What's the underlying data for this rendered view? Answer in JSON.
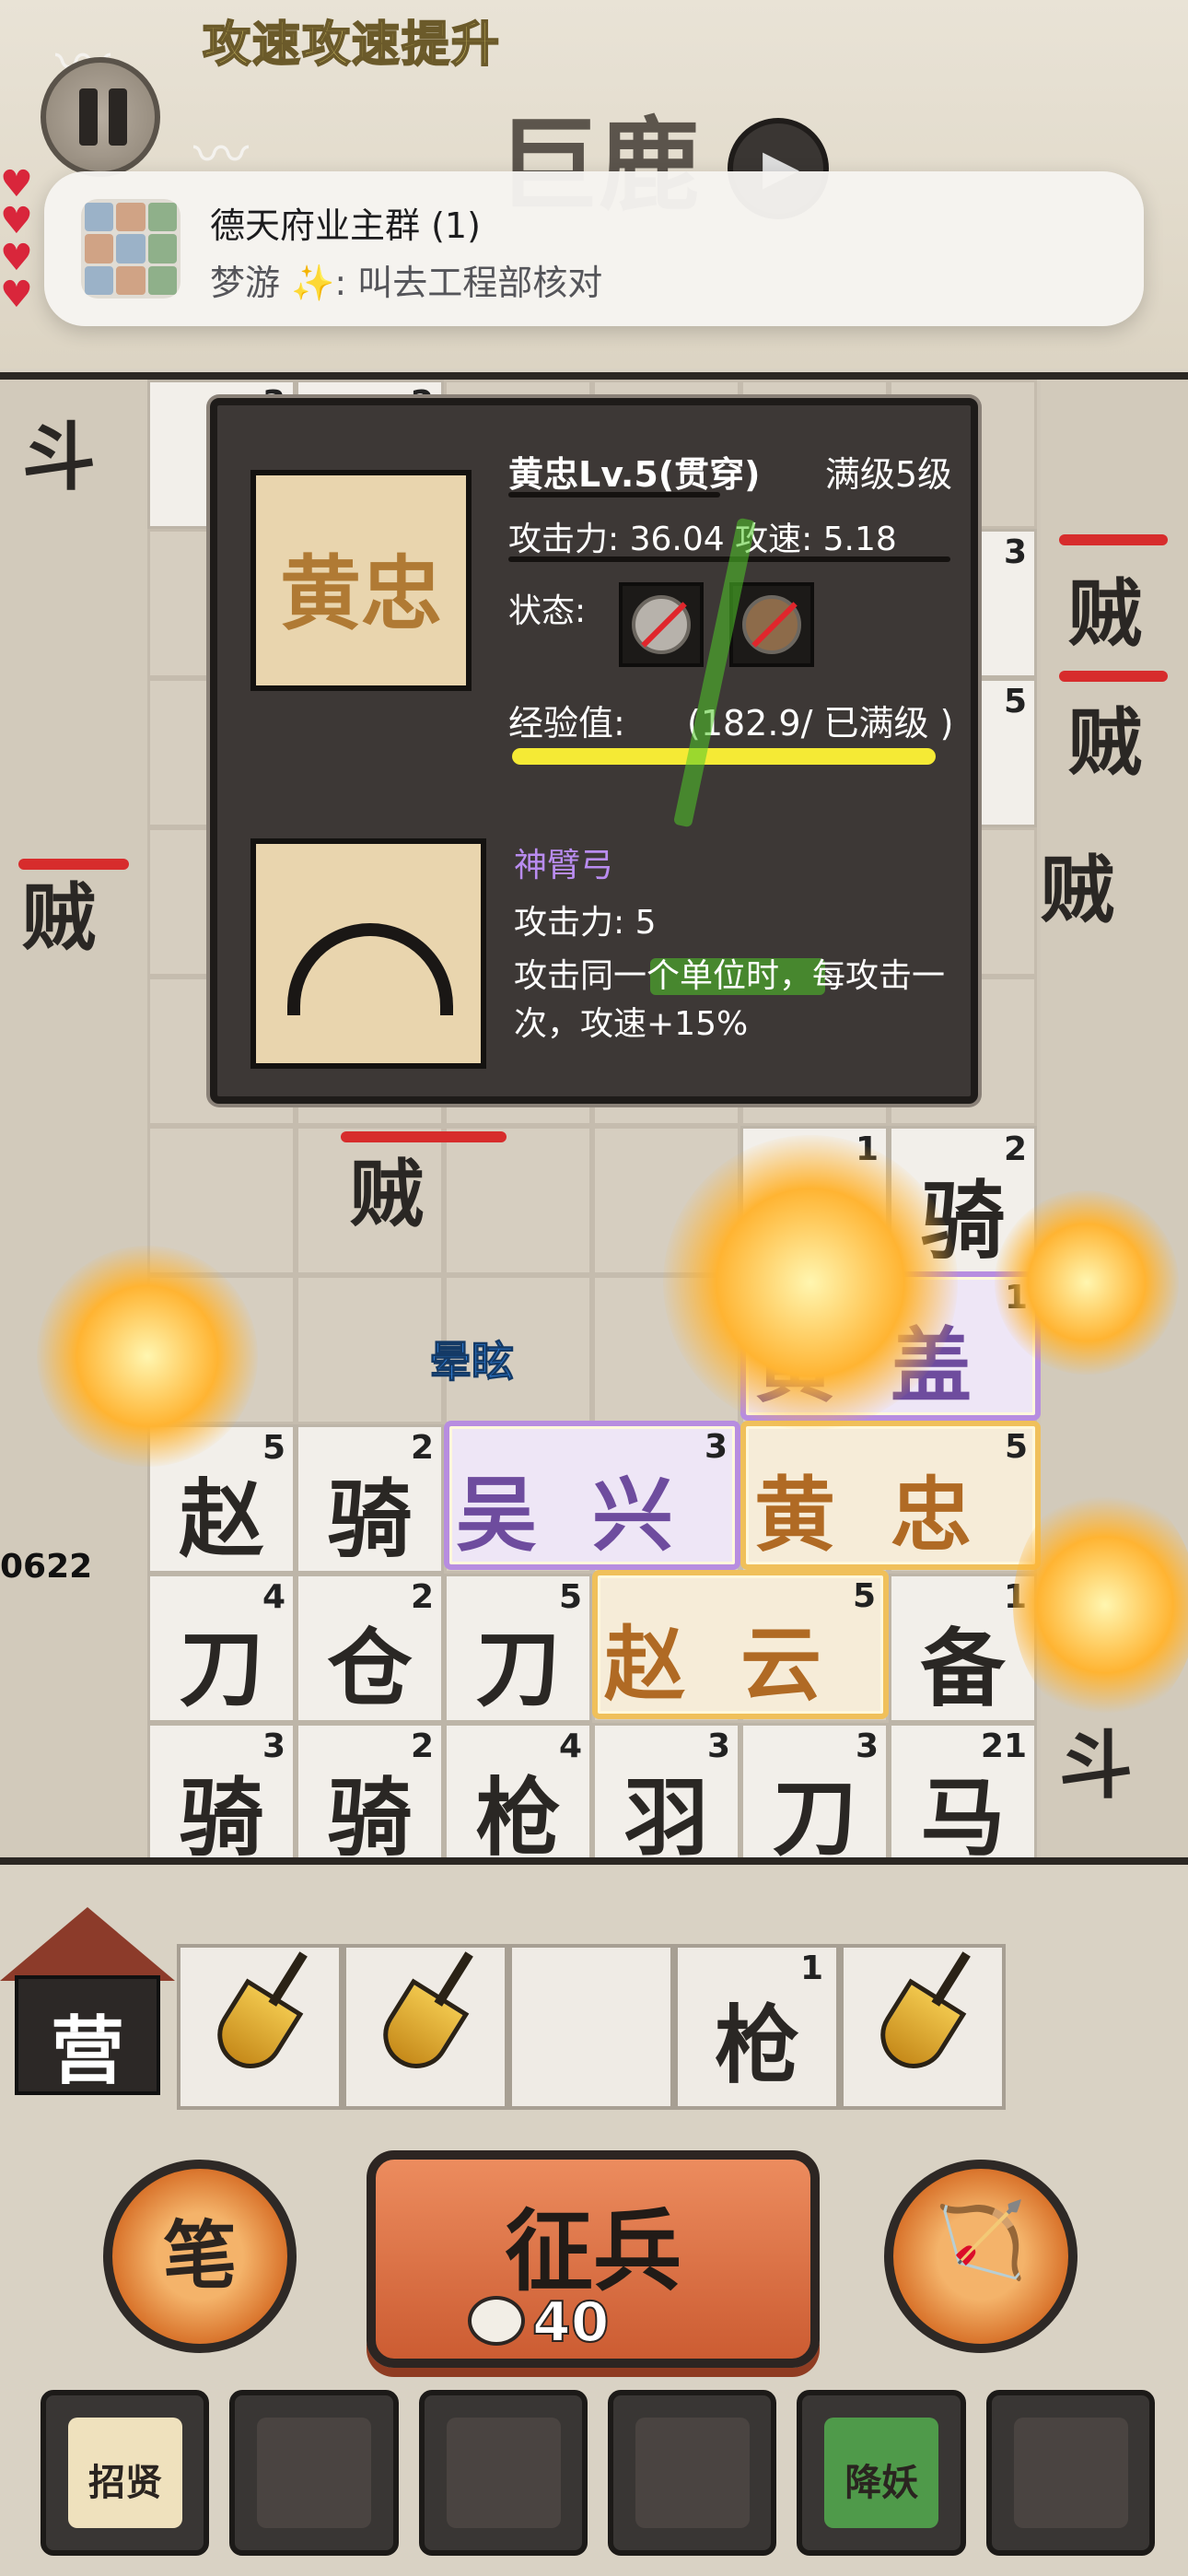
{
  "banner": {
    "buff_text": "攻速攻速提升"
  },
  "stage": {
    "name": "巨鹿"
  },
  "notification": {
    "title": "德天府业主群 (1)",
    "body": "梦游 ✨: 叫去工程部核对"
  },
  "board": {
    "rows": [
      [
        {
          "g": "",
          "l": "3"
        },
        {
          "g": "",
          "l": "2"
        },
        {
          "g": "",
          "l": ""
        },
        {
          "g": "",
          "l": ""
        },
        {
          "g": "",
          "l": ""
        },
        {
          "g": "",
          "l": ""
        }
      ],
      [
        {
          "g": "",
          "l": ""
        },
        {
          "g": "",
          "l": ""
        },
        {
          "g": "",
          "l": ""
        },
        {
          "g": "",
          "l": ""
        },
        {
          "g": "",
          "l": ""
        },
        {
          "g": "",
          "l": "3"
        }
      ],
      [
        {
          "g": "",
          "l": ""
        },
        {
          "g": "",
          "l": ""
        },
        {
          "g": "",
          "l": ""
        },
        {
          "g": "",
          "l": ""
        },
        {
          "g": "",
          "l": ""
        },
        {
          "g": "",
          "l": "5"
        }
      ],
      [
        {
          "g": "",
          "l": ""
        },
        {
          "g": "",
          "l": ""
        },
        {
          "g": "",
          "l": ""
        },
        {
          "g": "",
          "l": ""
        },
        {
          "g": "",
          "l": ""
        },
        {
          "g": "",
          "l": ""
        }
      ],
      [
        {
          "g": "",
          "l": ""
        },
        {
          "g": "",
          "l": ""
        },
        {
          "g": "",
          "l": ""
        },
        {
          "g": "",
          "l": ""
        },
        {
          "g": "",
          "l": ""
        },
        {
          "g": "",
          "l": ""
        }
      ],
      [
        {
          "g": "",
          "l": ""
        },
        {
          "g": "",
          "l": ""
        },
        {
          "g": "",
          "l": ""
        },
        {
          "g": "",
          "l": ""
        },
        {
          "g": "",
          "l": "1"
        },
        {
          "g": "骑",
          "l": "2"
        }
      ],
      [
        {
          "g": "",
          "l": ""
        },
        {
          "g": "",
          "l": ""
        },
        {
          "g": "",
          "l": ""
        },
        {
          "g": "",
          "l": ""
        },
        {
          "g": "",
          "l": ""
        },
        {
          "g": "",
          "l": ""
        }
      ],
      [
        {
          "g": "赵",
          "l": "5"
        },
        {
          "g": "骑",
          "l": "2"
        },
        {
          "g": "",
          "l": ""
        },
        {
          "g": "",
          "l": ""
        },
        {
          "g": "",
          "l": ""
        },
        {
          "g": "",
          "l": ""
        }
      ],
      [
        {
          "g": "刀",
          "l": "4"
        },
        {
          "g": "仓",
          "l": "2"
        },
        {
          "g": "刀",
          "l": "5"
        },
        {
          "g": "",
          "l": ""
        },
        {
          "g": "",
          "l": ""
        },
        {
          "g": "备",
          "l": "1"
        }
      ],
      [
        {
          "g": "骑",
          "l": "3"
        },
        {
          "g": "骑",
          "l": "2"
        },
        {
          "g": "枪",
          "l": "4"
        },
        {
          "g": "羽",
          "l": "3"
        },
        {
          "g": "刀",
          "l": "3"
        },
        {
          "g": "马",
          "l": "21"
        }
      ]
    ],
    "heroes": [
      {
        "name": "黄盖",
        "level": "1",
        "style": "purple"
      },
      {
        "name": "吴兴",
        "level": "3",
        "style": "purple"
      },
      {
        "name": "黄忠",
        "level": "5",
        "style": "gold"
      },
      {
        "name": "赵云",
        "level": "5",
        "style": "gold"
      }
    ],
    "enemies": [
      "斗",
      "贼",
      "贼",
      "贼",
      "贼",
      "贼",
      "斗"
    ],
    "stun_text": "晕眩",
    "damage_number": "0622"
  },
  "info_panel": {
    "portrait_text": "黄忠",
    "hero_title": "黄忠Lv.5(贯穿)",
    "max_level": "满级5级",
    "stats": "攻击力: 36.04 攻速: 5.18",
    "state_label": "状态:",
    "status_icons": [
      "armor-break-icon",
      "attack-speed-up-icon"
    ],
    "exp_label": "经验值:",
    "exp_value": "(182.9/ 已满级 )",
    "exp_fraction": 1.0,
    "weapon_name": "神臂弓",
    "weapon_attack": "攻击力: 5",
    "weapon_desc": "攻击同一个单位时，每攻击一次，攻速+15%"
  },
  "bench": {
    "camp_label": "营",
    "slots": [
      {
        "type": "shovel",
        "glyph": "",
        "level": ""
      },
      {
        "type": "shovel",
        "glyph": "",
        "level": ""
      },
      {
        "type": "empty",
        "glyph": "",
        "level": ""
      },
      {
        "type": "unit",
        "glyph": "枪",
        "level": "1"
      },
      {
        "type": "shovel",
        "glyph": "",
        "level": ""
      }
    ]
  },
  "controls": {
    "brush_label": "笔",
    "recruit_label": "征兵",
    "recruit_cost": "40",
    "bow_skill": "bow-fire-icon"
  },
  "skills": [
    {
      "icon": "scroll-icon",
      "text": "招贤",
      "color": "#efe1bd"
    },
    {
      "icon": "shovel-icon",
      "text": "",
      "color": "#4a4441"
    },
    {
      "icon": "blade-icon",
      "text": "",
      "color": "#4a4441"
    },
    {
      "icon": "treasure-dig-icon",
      "text": "",
      "color": "#4a4441"
    },
    {
      "icon": "subdue-demon-icon",
      "text": "降妖",
      "color": "#4f9a4a"
    },
    {
      "icon": "meteor-icon",
      "text": "",
      "color": "#4a4441"
    }
  ],
  "colors": {
    "accent_gold": "#f0c05a",
    "accent_purple": "#b78de0",
    "exp_bar": "#f5ea35",
    "recruit_button": "#d96a3c"
  }
}
